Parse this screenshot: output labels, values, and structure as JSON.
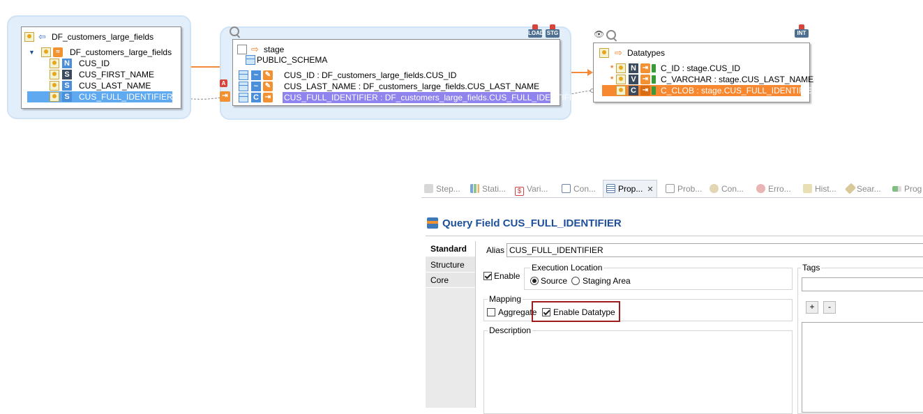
{
  "diagram": {
    "source": {
      "title": "DF_customers_large_fields",
      "model": "DF_customers_large_fields",
      "fields": [
        {
          "type": "N",
          "name": "CUS_ID"
        },
        {
          "type": "S",
          "name": "CUS_FIRST_NAME"
        },
        {
          "type": "S",
          "name": "CUS_LAST_NAME"
        },
        {
          "type": "S",
          "name": "CUS_FULL_IDENTIFIER"
        }
      ],
      "selected_index": 3
    },
    "stage": {
      "title": "stage",
      "schema": "PUBLIC_SCHEMA",
      "badge_load": "LOAD",
      "badge_stg": "STG",
      "fields": [
        {
          "type": "~",
          "expr": "CUS_ID : DF_customers_large_fields.CUS_ID"
        },
        {
          "type": "~",
          "expr": "CUS_LAST_NAME : DF_customers_large_fields.CUS_LAST_NAME"
        },
        {
          "type": "C",
          "expr": "CUS_FULL_IDENTIFIER : DF_customers_large_fields.CUS_FULL_IDENTIFIER"
        }
      ],
      "selected_index": 2
    },
    "target": {
      "title": "Datatypes",
      "badge_int": "INT",
      "fields": [
        {
          "type": "N",
          "expr": "C_ID : stage.CUS_ID"
        },
        {
          "type": "V",
          "expr": "C_VARCHAR : stage.CUS_LAST_NAME"
        },
        {
          "type": "C",
          "expr": "C_CLOB : stage.CUS_FULL_IDENTIFIER"
        }
      ],
      "selected_index": 2
    }
  },
  "tabs": [
    {
      "label": "Step...",
      "icon": "steps-icon",
      "active": false
    },
    {
      "label": "Stati...",
      "icon": "statistics-icon",
      "active": false
    },
    {
      "label": "Vari...",
      "icon": "variables-icon",
      "active": false
    },
    {
      "label": "Con...",
      "icon": "console-icon",
      "active": false
    },
    {
      "label": "Prop...",
      "icon": "properties-icon",
      "active": true
    },
    {
      "label": "Prob...",
      "icon": "problems-icon",
      "active": false
    },
    {
      "label": "Con...",
      "icon": "connection-icon",
      "active": false
    },
    {
      "label": "Erro...",
      "icon": "errors-icon",
      "active": false
    },
    {
      "label": "Hist...",
      "icon": "history-icon",
      "active": false
    },
    {
      "label": "Sear...",
      "icon": "search-icon",
      "active": false
    },
    {
      "label": "Prog",
      "icon": "progress-icon",
      "active": false
    }
  ],
  "properties": {
    "title": "Query Field CUS_FULL_IDENTIFIER",
    "vtabs": [
      "Standard",
      "Structure",
      "Core"
    ],
    "active_vtab": "Standard",
    "alias_label": "Alias",
    "alias_value": "CUS_FULL_IDENTIFIER",
    "enable_label": "Enable",
    "enable_checked": true,
    "execution_location": {
      "label": "Execution Location",
      "options": [
        "Source",
        "Staging Area"
      ],
      "selected": "Source"
    },
    "tags_label": "Tags",
    "tags_value": "",
    "add_label": "+",
    "remove_label": "-",
    "mapping": {
      "label": "Mapping",
      "aggregate_label": "Aggregate",
      "aggregate_checked": false,
      "enable_datatype_label": "Enable Datatype",
      "enable_datatype_checked": true
    },
    "description_label": "Description",
    "description_value": ""
  },
  "colors": {
    "selection_blue": "#5ea9f0",
    "selection_purple": "#8f83ee",
    "selection_orange": "#f7882f",
    "link_orange": "#f58a3a",
    "title_blue": "#1d4f9a",
    "highlight_red": "#9e1b1b"
  }
}
